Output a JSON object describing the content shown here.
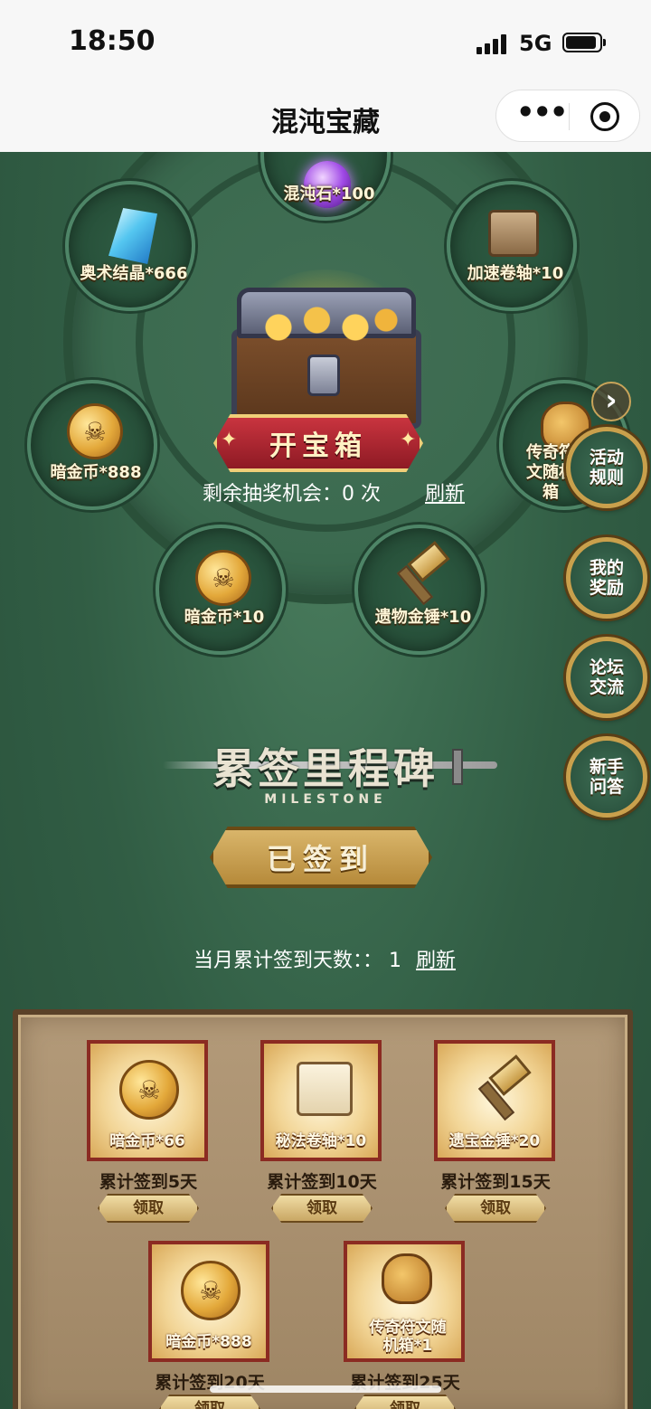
{
  "status_bar": {
    "time": "18:50",
    "network": "5G"
  },
  "title_bar": {
    "title": "混沌宝藏"
  },
  "wheel": {
    "prizes": [
      {
        "label": "混沌石*100",
        "icon": "chaos-stone-icon"
      },
      {
        "label": "奥术结晶*666",
        "icon": "arcane-crystal-icon"
      },
      {
        "label": "加速卷轴*10",
        "icon": "speed-scroll-icon"
      },
      {
        "label": "暗金币*888",
        "icon": "coin-pile-icon"
      },
      {
        "label": "传奇符文随机箱",
        "icon": "rune-bag-icon"
      },
      {
        "label": "暗金币*10",
        "icon": "dark-coin-icon"
      },
      {
        "label": "遗物金锤*10",
        "icon": "relic-hammer-icon"
      }
    ],
    "open_button": "开宝箱",
    "remaining_label": "剩余抽奖机会：",
    "remaining_count": "0",
    "remaining_unit": "次",
    "refresh": "刷新"
  },
  "side_menu": [
    {
      "label": "活动规则"
    },
    {
      "label": "我的奖励"
    },
    {
      "label": "论坛交流"
    },
    {
      "label": "新手问答"
    }
  ],
  "milestone": {
    "title": "累签里程碑",
    "subtitle": "MILESTONE",
    "signed_button": "已签到",
    "month_label": "当月累计签到天数：：",
    "month_days": "1",
    "refresh": "刷新"
  },
  "rewards": [
    {
      "name": "暗金币*66",
      "day": "累计签到5天",
      "claim": "领取",
      "icon": "dark-coin-icon"
    },
    {
      "name": "秘法卷轴*10",
      "day": "累计签到10天",
      "claim": "领取",
      "icon": "mystic-scroll-icon"
    },
    {
      "name": "遗宝金锤*20",
      "day": "累计签到15天",
      "claim": "领取",
      "icon": "golden-hammer-icon"
    },
    {
      "name": "暗金币*888",
      "day": "累计签到20天",
      "claim": "领取",
      "icon": "dark-coin-icon"
    },
    {
      "name": "传奇符文随机箱*1",
      "day": "累计签到25天",
      "claim": "领取",
      "icon": "rune-bag-icon"
    }
  ],
  "colors": {
    "background": "#2f5a44",
    "open_button": "#b02a35",
    "gold": "#c9a04c",
    "parchment": "#a88f6e"
  }
}
